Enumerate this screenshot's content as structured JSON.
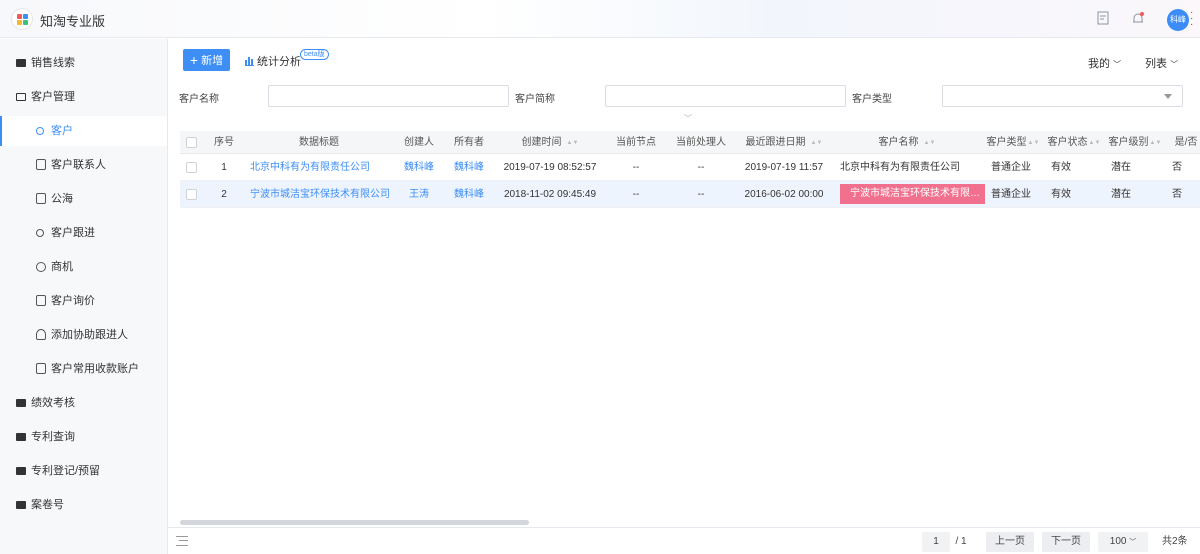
{
  "app": {
    "title": "知淘专业版",
    "avatar_text": "科峰"
  },
  "topbar_icons": [
    "document-icon",
    "bell-icon"
  ],
  "sidebar": {
    "items": [
      {
        "label": "销售线索",
        "type": "folder"
      },
      {
        "label": "客户管理",
        "type": "folder-open"
      },
      {
        "label": "客户",
        "type": "sub",
        "active": true
      },
      {
        "label": "客户联系人",
        "type": "sub"
      },
      {
        "label": "公海",
        "type": "sub"
      },
      {
        "label": "客户跟进",
        "type": "sub"
      },
      {
        "label": "商机",
        "type": "sub"
      },
      {
        "label": "客户询价",
        "type": "sub"
      },
      {
        "label": "添加协助跟进人",
        "type": "sub"
      },
      {
        "label": "客户常用收款账户",
        "type": "sub"
      },
      {
        "label": "绩效考核",
        "type": "folder"
      },
      {
        "label": "专利查询",
        "type": "folder"
      },
      {
        "label": "专利登记/预留",
        "type": "folder"
      },
      {
        "label": "案卷号",
        "type": "folder"
      }
    ]
  },
  "toolbar": {
    "new_label": "新增",
    "stats_label": "统计分析",
    "beta_label": "beta版",
    "mine_label": "我的",
    "list_label": "列表"
  },
  "filters": {
    "name_label": "客户名称",
    "short_label": "客户简称",
    "type_label": "客户类型",
    "name_value": "",
    "short_value": "",
    "type_value": ""
  },
  "table": {
    "headers": [
      "序号",
      "数据标题",
      "创建人",
      "所有者",
      "创建时间",
      "当前节点",
      "当前处理人",
      "最近跟进日期",
      "客户名称",
      "客户类型",
      "客户状态",
      "客户级别",
      "是/否"
    ],
    "rows": [
      [
        "1",
        "北京中科有为有限责任公司",
        "魏科峰",
        "魏科峰",
        "2019-07-19 08:52:57",
        "--",
        "--",
        "2019-07-19 11:57",
        "北京中科有为有限责任公司",
        "普通企业",
        "有效",
        "潜在",
        "否"
      ],
      [
        "2",
        "宁波市城洁宝环保技术有限公司",
        "王涛",
        "魏科峰",
        "2018-11-02 09:45:49",
        "--",
        "--",
        "2016-06-02 00:00",
        "宁波市城洁宝环保技术有限…",
        "普通企业",
        "有效",
        "潜在",
        "否"
      ]
    ]
  },
  "pagination": {
    "page": "1",
    "total_pages": "/ 1",
    "prev_label": "上一页",
    "next_label": "下一页",
    "page_size": "100",
    "total_label": "共2条"
  },
  "colors": {
    "accent": "#3d8ef5",
    "highlight": "#f1708e",
    "row_alt": "#eef4fd"
  }
}
